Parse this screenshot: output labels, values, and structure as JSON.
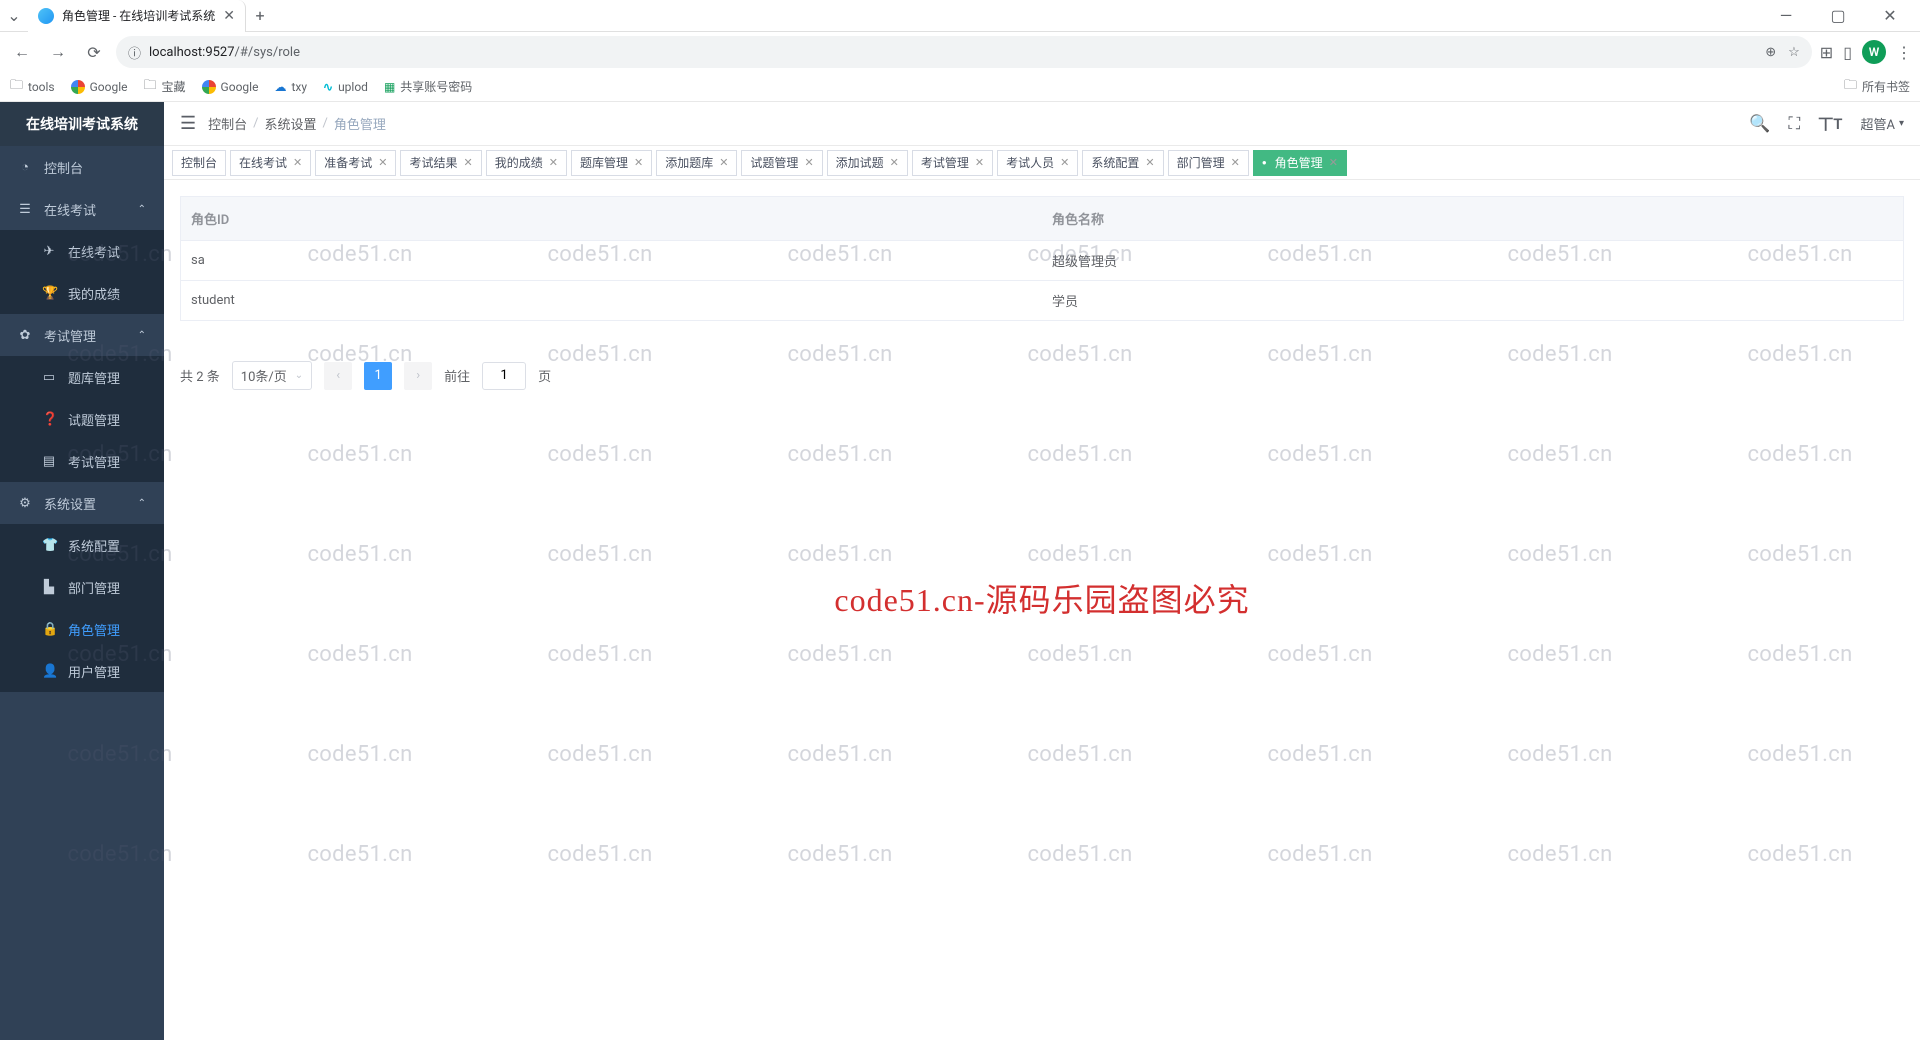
{
  "browser": {
    "tab_title": "角色管理 - 在线培训考试系统",
    "url_host": "localhost:9527",
    "url_path": "/#/sys/role"
  },
  "window_controls": {
    "min": "—",
    "max": "▢",
    "close": "✕"
  },
  "bookmarks": {
    "left": [
      "tools",
      "Google",
      "宝藏",
      "Google",
      "txy",
      "uplod",
      "共享账号密码"
    ],
    "right": "所有书签"
  },
  "sidebar": {
    "title": "在线培训考试系统",
    "items": [
      {
        "icon": "◔",
        "label": "控制台",
        "sub": false,
        "expand": ""
      },
      {
        "icon": "☰",
        "label": "在线考试",
        "sub": false,
        "expand": "⌃"
      },
      {
        "icon": "✈",
        "label": "在线考试",
        "sub": true,
        "expand": ""
      },
      {
        "icon": "🏆",
        "label": "我的成绩",
        "sub": true,
        "expand": ""
      },
      {
        "icon": "✿",
        "label": "考试管理",
        "sub": false,
        "expand": "⌃"
      },
      {
        "icon": "▭",
        "label": "题库管理",
        "sub": true,
        "expand": ""
      },
      {
        "icon": "❓",
        "label": "试题管理",
        "sub": true,
        "expand": ""
      },
      {
        "icon": "▤",
        "label": "考试管理",
        "sub": true,
        "expand": ""
      },
      {
        "icon": "⚙",
        "label": "系统设置",
        "sub": false,
        "expand": "⌃"
      },
      {
        "icon": "👕",
        "label": "系统配置",
        "sub": true,
        "expand": ""
      },
      {
        "icon": "▙",
        "label": "部门管理",
        "sub": true,
        "expand": ""
      },
      {
        "icon": "🔒",
        "label": "角色管理",
        "sub": true,
        "expand": "",
        "active": true
      },
      {
        "icon": "👤",
        "label": "用户管理",
        "sub": true,
        "expand": ""
      }
    ]
  },
  "breadcrumb": {
    "items": [
      "控制台",
      "系统设置",
      "角色管理"
    ]
  },
  "topbar": {
    "user": "超管A"
  },
  "tabs": [
    {
      "label": "控制台",
      "closable": false
    },
    {
      "label": "在线考试",
      "closable": true
    },
    {
      "label": "准备考试",
      "closable": true
    },
    {
      "label": "考试结果",
      "closable": true
    },
    {
      "label": "我的成绩",
      "closable": true
    },
    {
      "label": "题库管理",
      "closable": true
    },
    {
      "label": "添加题库",
      "closable": true
    },
    {
      "label": "试题管理",
      "closable": true
    },
    {
      "label": "添加试题",
      "closable": true
    },
    {
      "label": "考试管理",
      "closable": true
    },
    {
      "label": "考试人员",
      "closable": true
    },
    {
      "label": "系统配置",
      "closable": true
    },
    {
      "label": "部门管理",
      "closable": true
    },
    {
      "label": "角色管理",
      "closable": true,
      "active": true
    }
  ],
  "table": {
    "headers": [
      "角色ID",
      "角色名称"
    ],
    "rows": [
      {
        "id": "sa",
        "name": "超级管理员"
      },
      {
        "id": "student",
        "name": "学员"
      }
    ]
  },
  "pagination": {
    "total_text": "共 2 条",
    "page_size": "10条/页",
    "current": "1",
    "goto_label": "前往",
    "goto_value": "1",
    "goto_suffix": "页"
  },
  "watermark": {
    "text": "code51.cn",
    "big": "code51.cn-源码乐园盗图必究"
  }
}
